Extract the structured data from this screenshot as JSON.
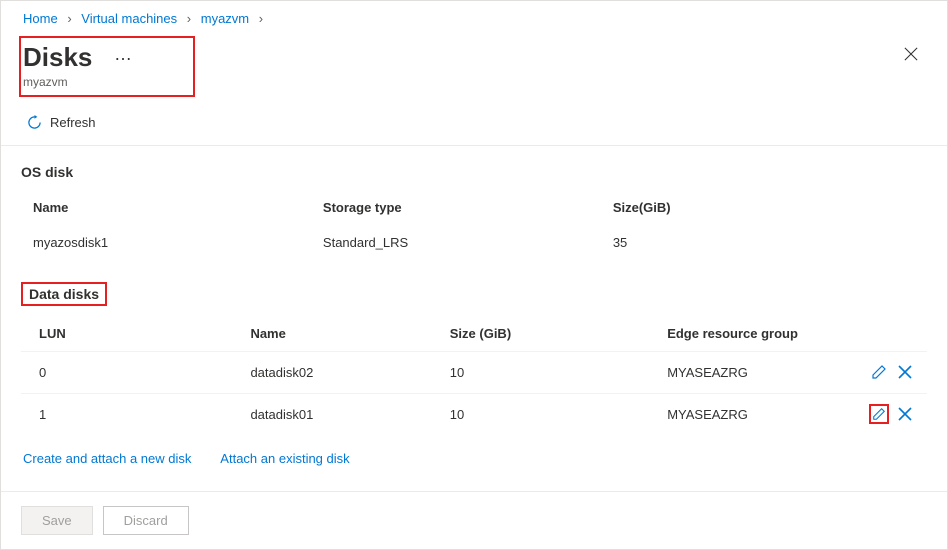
{
  "breadcrumb": {
    "items": [
      "Home",
      "Virtual machines",
      "myazvm"
    ]
  },
  "header": {
    "title": "Disks",
    "subtitle": "myazvm"
  },
  "toolbar": {
    "refresh": "Refresh"
  },
  "osDisk": {
    "heading": "OS disk",
    "columns": {
      "name": "Name",
      "storage": "Storage type",
      "size": "Size(GiB)"
    },
    "row": {
      "name": "myazosdisk1",
      "storage": "Standard_LRS",
      "size": "35"
    }
  },
  "dataDisks": {
    "heading": "Data disks",
    "columns": {
      "lun": "LUN",
      "name": "Name",
      "size": "Size (GiB)",
      "rg": "Edge resource group"
    },
    "rows": [
      {
        "lun": "0",
        "name": "datadisk02",
        "size": "10",
        "rg": "MYASEAZRG"
      },
      {
        "lun": "1",
        "name": "datadisk01",
        "size": "10",
        "rg": "MYASEAZRG"
      }
    ]
  },
  "links": {
    "create": "Create and attach a new disk",
    "attach": "Attach an existing disk"
  },
  "footer": {
    "save": "Save",
    "discard": "Discard"
  }
}
